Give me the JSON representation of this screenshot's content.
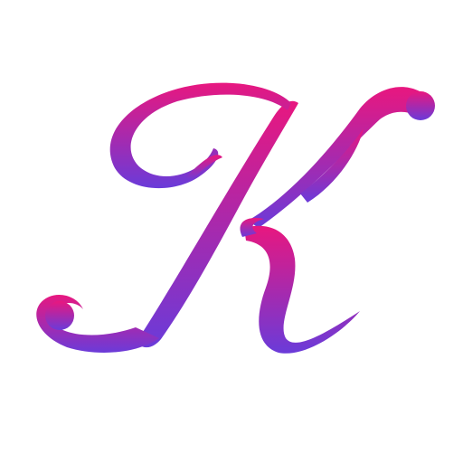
{
  "logo": {
    "letter": "K",
    "style": "script",
    "icon": "script-k-logo-icon",
    "gradient": {
      "direction": "top-to-bottom",
      "top_color": "#E8177F",
      "bottom_color": "#6A3BD9"
    },
    "background_color": "#FFFFFF"
  }
}
